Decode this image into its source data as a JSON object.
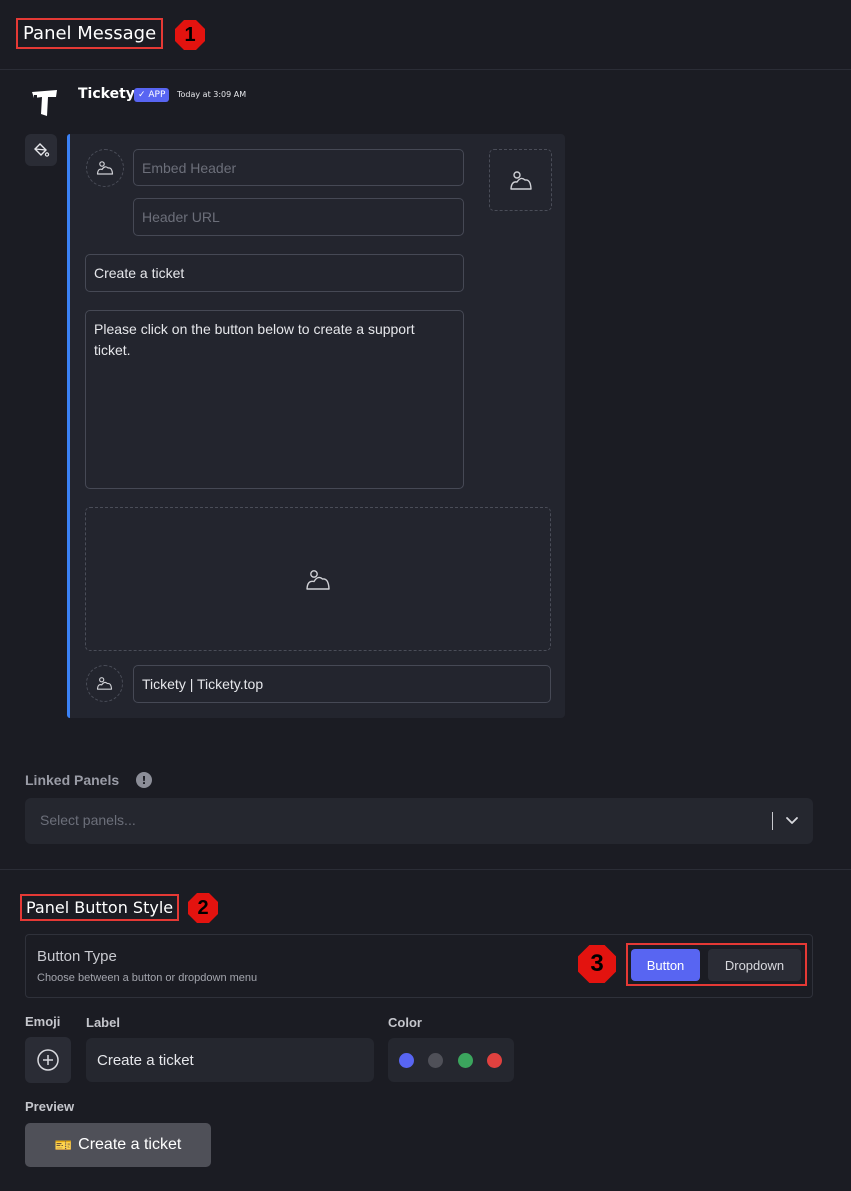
{
  "sections": {
    "panel_message": {
      "title": "Panel Message",
      "annotation": "1"
    },
    "panel_button_style": {
      "title": "Panel Button Style",
      "annotation": "2"
    },
    "toggle_annotation": "3"
  },
  "message": {
    "bot_name": "Tickety",
    "app_tag": "✓ APP",
    "timestamp": "Today at 3:09 AM"
  },
  "embed": {
    "accent_color": "#3b82f6",
    "header_placeholder": "Embed Header",
    "header_url_placeholder": "Header URL",
    "title": "Create a ticket",
    "description": "Please click on the button below to create a support ticket.",
    "footer_text": "Tickety | Tickety.top"
  },
  "linked_panels": {
    "label": "Linked Panels",
    "info_icon": "!",
    "placeholder": "Select panels..."
  },
  "button_type": {
    "title": "Button Type",
    "description": "Choose between a button or dropdown menu",
    "options": [
      "Button",
      "Dropdown"
    ],
    "selected": "Button"
  },
  "button_config": {
    "emoji_label": "Emoji",
    "label_label": "Label",
    "label_value": "Create a ticket",
    "color_label": "Color",
    "colors": [
      "#5865f2",
      "#4f5058",
      "#3ba55d",
      "#e0413f"
    ],
    "preview_label": "Preview",
    "preview_emoji": "🎫",
    "preview_text": "Create a ticket"
  }
}
